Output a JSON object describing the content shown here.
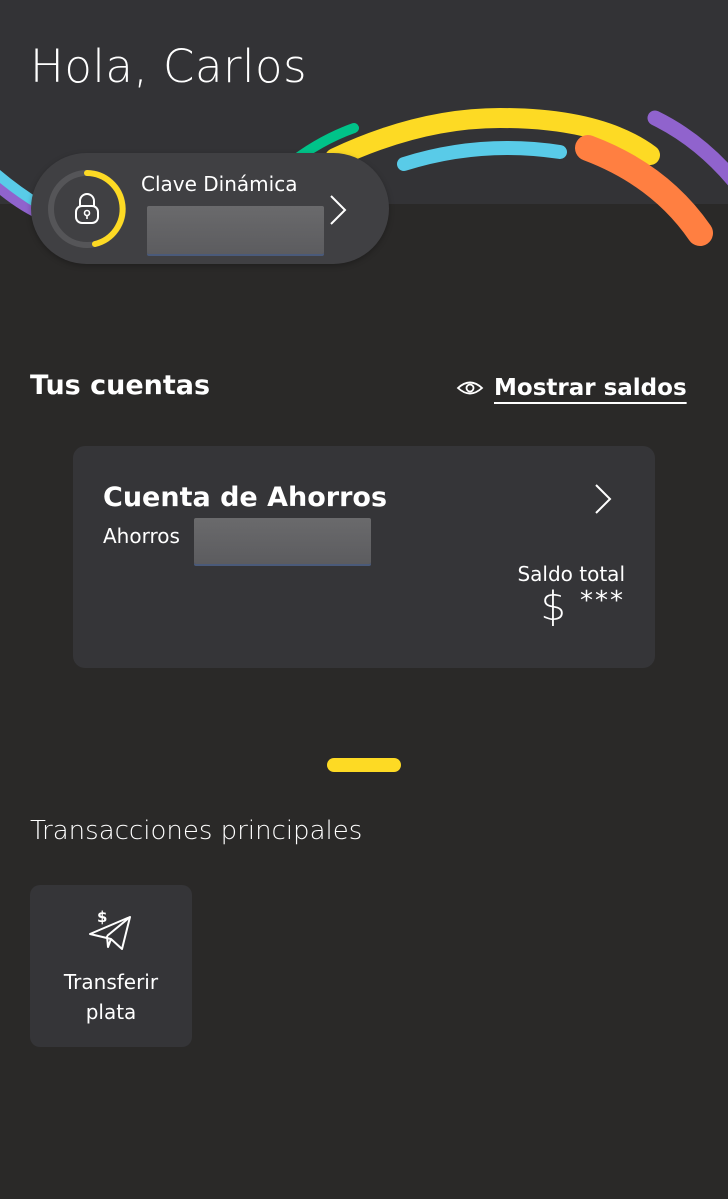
{
  "header": {
    "greeting": "Hola, Carlos"
  },
  "clave": {
    "label": "Clave Dinámica"
  },
  "accounts": {
    "section_title": "Tus cuentas",
    "show_balances_label": "Mostrar saldos",
    "card": {
      "name": "Cuenta de Ahorros",
      "type": "Ahorros",
      "total_label": "Saldo total",
      "currency": "$",
      "masked_balance": "***"
    }
  },
  "transactions": {
    "section_title": "Transacciones principales",
    "items": [
      {
        "label_line1": "Transferir",
        "label_line2": "plata",
        "icon": "send-money-icon"
      }
    ]
  },
  "colors": {
    "accent_yellow": "#fdda24",
    "decor_green": "#00c389",
    "decor_blue": "#59cbe8",
    "decor_orange": "#ff7f41",
    "decor_purple": "#9063cd"
  }
}
